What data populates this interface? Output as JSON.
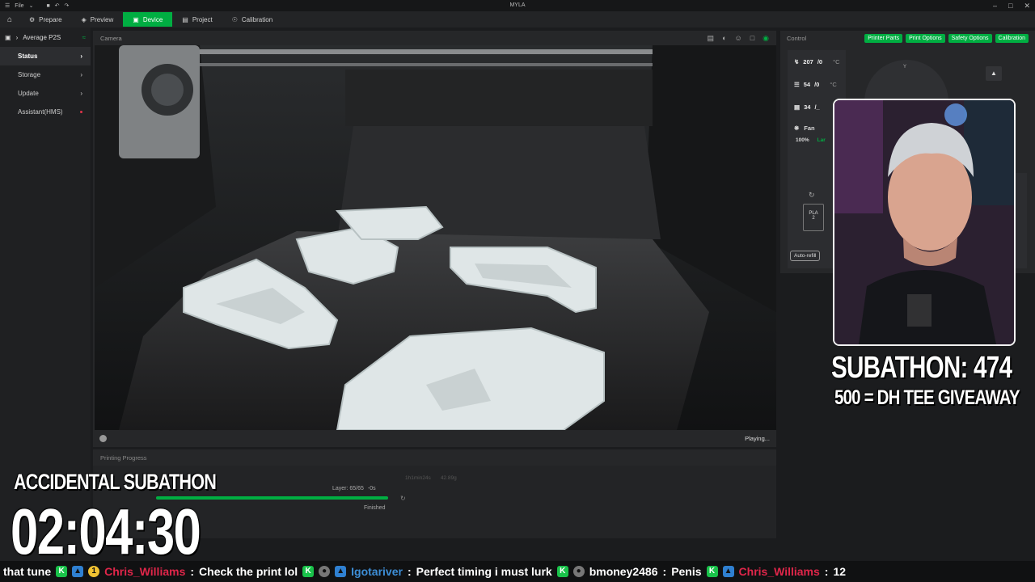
{
  "titlebar": {
    "file_menu": "File",
    "title": "MYLA"
  },
  "nav": {
    "tabs": [
      {
        "label": "Prepare"
      },
      {
        "label": "Preview"
      },
      {
        "label": "Device"
      },
      {
        "label": "Project"
      },
      {
        "label": "Calibration"
      }
    ],
    "active_tab": "Device"
  },
  "sidebar": {
    "device_name": "Average P2S",
    "items": [
      {
        "label": "Status"
      },
      {
        "label": "Storage"
      },
      {
        "label": "Update"
      },
      {
        "label": "Assistant(HMS)"
      }
    ]
  },
  "camera": {
    "title": "Camera",
    "state": "Playing..."
  },
  "progress": {
    "title": "Printing Progress",
    "time_info": "1h1min24s",
    "weight": "42.89g",
    "layer": "Layer: 65/65",
    "remaining": "-0s",
    "status": "Finished",
    "percent": 100
  },
  "control": {
    "title": "Control",
    "buttons": [
      "Printer Parts",
      "Print Options",
      "Safety Options",
      "Calibration"
    ],
    "nozzle_temp": "207",
    "nozzle_target": "/0",
    "bed_temp": "54",
    "bed_target": "/0",
    "chamber_temp": "34",
    "chamber_target": "/_",
    "temp_unit": "°C",
    "fan_label": "Fan",
    "fan_speed": "100%",
    "fan_sub": "Lar",
    "jog_axis": "Y",
    "ams_slot_label": "PLA",
    "ams_slot_num": "2",
    "auto_refill": "Auto-refill"
  },
  "overlay": {
    "subathon_count": "SUBATHON: 474",
    "giveaway": "500 = DH TEE GIVEAWAY",
    "accidental": "ACCIDENTAL SUBATHON",
    "timer": "02:04:30"
  },
  "chat": [
    {
      "user": "",
      "text": "that tune"
    },
    {
      "user": "Chris_Williams",
      "text": "Check the print lol"
    },
    {
      "user": "Igotariver",
      "text": "Perfect timing i must lurk"
    },
    {
      "user": "bmoney2486",
      "text": "Penis"
    },
    {
      "user": "Chris_Williams",
      "text": "12"
    }
  ],
  "colors": {
    "accent": "#00ae42",
    "chat_red": "#e0264a",
    "chat_blue": "#3d8ed6"
  }
}
